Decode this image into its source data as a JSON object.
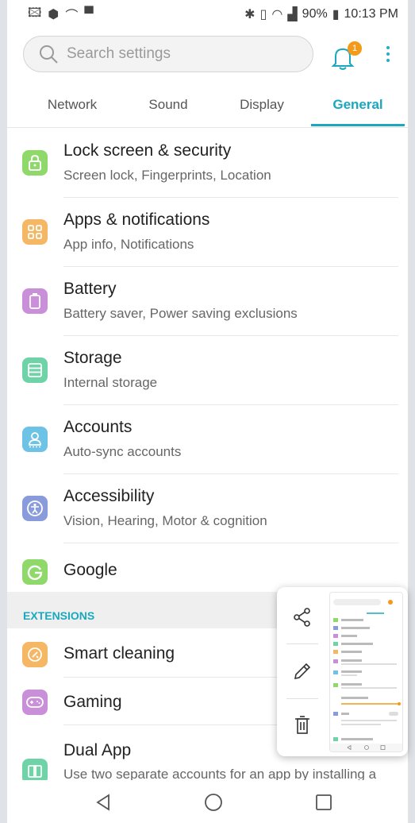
{
  "status_bar": {
    "battery_pct": "90%",
    "time": "10:13 PM"
  },
  "search": {
    "placeholder": "Search settings",
    "notification_count": "1"
  },
  "tabs": [
    {
      "label": "Network",
      "active": false
    },
    {
      "label": "Sound",
      "active": false
    },
    {
      "label": "Display",
      "active": false
    },
    {
      "label": "General",
      "active": true
    }
  ],
  "items": [
    {
      "title": "Lock screen & security",
      "subtitle": "Screen lock, Fingerprints, Location",
      "icon": "lock-icon",
      "color": "#8fd86a"
    },
    {
      "title": "Apps & notifications",
      "subtitle": "App info, Notifications",
      "icon": "apps-grid-icon",
      "color": "#f6b765"
    },
    {
      "title": "Battery",
      "subtitle": "Battery saver, Power saving exclusions",
      "icon": "battery-icon",
      "color": "#c98fd8"
    },
    {
      "title": "Storage",
      "subtitle": "Internal storage",
      "icon": "storage-icon",
      "color": "#6fd3a8"
    },
    {
      "title": "Accounts",
      "subtitle": "Auto-sync accounts",
      "icon": "account-icon",
      "color": "#6cc3e6"
    },
    {
      "title": "Accessibility",
      "subtitle": "Vision, Hearing, Motor & cognition",
      "icon": "accessibility-icon",
      "color": "#8a9bdc"
    },
    {
      "title": "Google",
      "subtitle": "",
      "icon": "google-icon",
      "color": "#8fd86a"
    }
  ],
  "extensions": {
    "header": "EXTENSIONS",
    "items": [
      {
        "title": "Smart cleaning",
        "subtitle": "",
        "icon": "smart-cleaning-icon",
        "color": "#f6b765"
      },
      {
        "title": "Gaming",
        "subtitle": "",
        "icon": "gamepad-icon",
        "color": "#c98fd8"
      },
      {
        "title": "Dual App",
        "subtitle": "Use two separate accounts for an app by installing a",
        "icon": "dual-app-icon",
        "color": "#6fd3a8"
      }
    ]
  },
  "accent_color": "#1aa8be",
  "screenshot_panel_actions": [
    "share-icon",
    "edit-pencil-icon",
    "delete-icon"
  ]
}
